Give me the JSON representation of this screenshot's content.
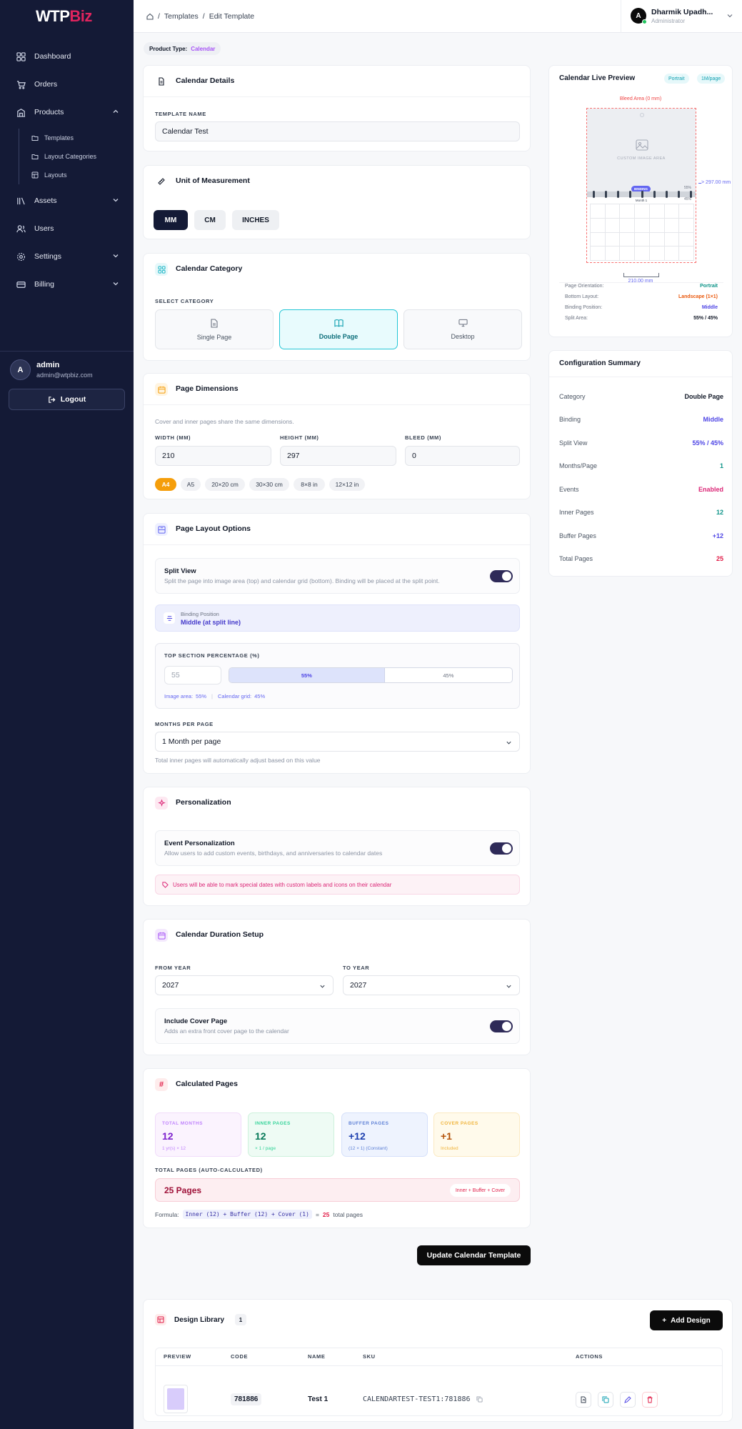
{
  "sidebar": {
    "logo_a": "WTP",
    "logo_b": "Biz",
    "items": [
      {
        "label": "Dashboard"
      },
      {
        "label": "Orders"
      },
      {
        "label": "Products"
      },
      {
        "label": "Assets"
      },
      {
        "label": "Users"
      },
      {
        "label": "Settings"
      },
      {
        "label": "Billing"
      }
    ],
    "sub_items": [
      {
        "label": "Templates"
      },
      {
        "label": "Layout Categories"
      },
      {
        "label": "Layouts"
      }
    ],
    "user": {
      "initial": "A",
      "name": "admin",
      "email": "admin@wtpbiz.com"
    },
    "logout_label": "Logout"
  },
  "topbar": {
    "breadcrumb": [
      "Templates",
      "Edit Template"
    ],
    "user": {
      "initial": "A",
      "name": "Dharmik Upadh...",
      "role": "Administrator"
    }
  },
  "product_type": {
    "label": "Product Type:",
    "value": "Calendar"
  },
  "calendar_details": {
    "title": "Calendar Details",
    "name_label": "TEMPLATE NAME",
    "name_value": "Calendar Test"
  },
  "unit": {
    "title": "Unit of Measurement",
    "options": [
      "MM",
      "CM",
      "INCHES"
    ],
    "selected": "MM"
  },
  "category": {
    "title": "Calendar Category",
    "select_label": "SELECT CATEGORY",
    "options": [
      "Single Page",
      "Double Page",
      "Desktop"
    ],
    "selected": "Double Page"
  },
  "dimensions": {
    "title": "Page Dimensions",
    "note": "Cover and inner pages share the same dimensions.",
    "width_label": "WIDTH (MM)",
    "width": "210",
    "height_label": "HEIGHT (MM)",
    "height": "297",
    "bleed_label": "BLEED (MM)",
    "bleed": "0",
    "presets": [
      "A4",
      "A5",
      "20×20 cm",
      "30×30 cm",
      "8×8 in",
      "12×12 in"
    ],
    "active_preset": "A4"
  },
  "layout": {
    "title": "Page Layout Options",
    "split_title": "Split View",
    "split_desc": "Split the page into image area (top) and calendar grid (bottom). Binding will be placed at the split point.",
    "split_on": true,
    "binding_label": "Binding Position",
    "binding_value": "Middle (at split line)",
    "top_pct_label": "TOP SECTION PERCENTAGE (%)",
    "top_pct_placeholder": "55",
    "top_pct": 55,
    "bar_left": "55%",
    "bar_right": "45%",
    "image_area_label": "Image area:",
    "image_area_value": "55%",
    "grid_label": "Calendar grid:",
    "grid_value": "45%",
    "months_label": "MONTHS PER PAGE",
    "months_value": "1 Month per page",
    "months_note": "Total inner pages will automatically adjust based on this value"
  },
  "personalization": {
    "title": "Personalization",
    "event_title": "Event Personalization",
    "event_desc": "Allow users to add custom events, birthdays, and anniversaries to calendar dates",
    "event_on": true,
    "notice": "Users will be able to mark special dates with custom labels and icons on their calendar"
  },
  "duration": {
    "title": "Calendar Duration Setup",
    "from_label": "FROM YEAR",
    "from": "2027",
    "to_label": "TO YEAR",
    "to": "2027",
    "cover_title": "Include Cover Page",
    "cover_desc": "Adds an extra front cover page to the calendar",
    "cover_on": true
  },
  "calculated": {
    "title": "Calculated Pages",
    "stats": [
      {
        "label": "TOTAL MONTHS",
        "value": "12",
        "sub": "1 yr(s) × 12"
      },
      {
        "label": "INNER PAGES",
        "value": "12",
        "sub": "× 1 / page"
      },
      {
        "label": "BUFFER PAGES",
        "value": "+12",
        "sub": "(12 × 1) (Constant)"
      },
      {
        "label": "COVER PAGES",
        "value": "+1",
        "sub": "Included"
      }
    ],
    "total_label": "TOTAL PAGES (AUTO-CALCULATED)",
    "total_value": "25 Pages",
    "total_badge": "Inner + Buffer + Cover",
    "formula_label": "Formula:",
    "formula_code": "Inner (12) + Buffer (12) + Cover (1)",
    "formula_eq": "=",
    "formula_total": "25",
    "formula_suffix": "total pages"
  },
  "update_label": "Update Calendar Template",
  "preview": {
    "title": "Calendar Live Preview",
    "badges": [
      "Portrait",
      "1M/page"
    ],
    "bleed_label": "Bleed Area (0 mm)",
    "image_area": "CUSTOM IMAGE AREA",
    "binding": "BINDING",
    "month": "Month 1",
    "pct_top": "55%",
    "pct_bottom": "45%",
    "height_dim": "297.00 mm",
    "width_dim": "210.00 mm",
    "rows": [
      {
        "label": "Page Orientation:",
        "value": "Portrait",
        "color": "#0d9488"
      },
      {
        "label": "Bottom Layout:",
        "value": "Landscape (1×1)",
        "color": "#ea580c"
      },
      {
        "label": "Binding Position:",
        "value": "Middle",
        "color": "#4f46e5"
      },
      {
        "label": "Split Area:",
        "value": "55% / 45%",
        "color": "#111827"
      }
    ]
  },
  "summary": {
    "title": "Configuration Summary",
    "rows": [
      {
        "label": "Category",
        "value": "Double Page",
        "color": "#111827"
      },
      {
        "label": "Binding",
        "value": "Middle",
        "color": "#4f46e5"
      },
      {
        "label": "Split View",
        "value": "55% / 45%",
        "color": "#4f46e5"
      },
      {
        "label": "Months/Page",
        "value": "1",
        "color": "#0d9488"
      },
      {
        "label": "Events",
        "value": "Enabled",
        "color": "#db2777"
      },
      {
        "label": "Inner Pages",
        "value": "12",
        "color": "#0d9488"
      },
      {
        "label": "Buffer Pages",
        "value": "+12",
        "color": "#4f46e5"
      },
      {
        "label": "Total Pages",
        "value": "25",
        "color": "#e11d48"
      }
    ]
  },
  "library": {
    "title": "Design Library",
    "count": "1",
    "add_label": "Add Design",
    "columns": [
      "PREVIEW",
      "CODE",
      "NAME",
      "SKU",
      "ACTIONS"
    ],
    "rows": [
      {
        "code": "781886",
        "name": "Test 1",
        "sku": "CALENDARTEST-TEST1:781886"
      }
    ]
  },
  "colors": {
    "sidebar_bg": "#141a36",
    "brand_red": "#e0245e",
    "accent_teal": "#22c5d6",
    "accent_indigo": "#4f46e5",
    "primary_dark": "#0b0b0b"
  }
}
